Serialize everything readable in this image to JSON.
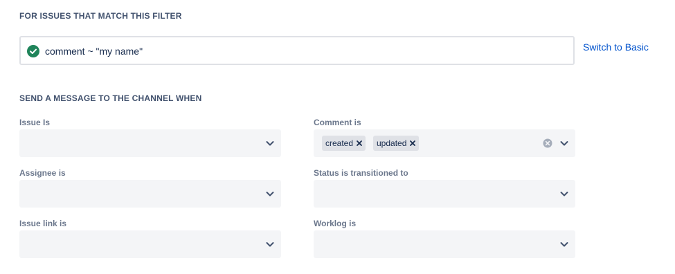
{
  "filter_section": {
    "heading": "FOR ISSUES THAT MATCH THIS FILTER",
    "jql_value": "comment ~ \"my name\"",
    "jql_status": "valid",
    "switch_link": "Switch to Basic"
  },
  "message_section": {
    "heading": "SEND A MESSAGE TO THE CHANNEL WHEN",
    "fields": {
      "issue_is": {
        "label": "Issue Is",
        "selected": []
      },
      "comment_is": {
        "label": "Comment is",
        "selected": [
          "created",
          "updated"
        ]
      },
      "assignee_is": {
        "label": "Assignee is",
        "selected": []
      },
      "status_transitioned": {
        "label": "Status is transitioned to",
        "selected": []
      },
      "issue_link_is": {
        "label": "Issue link is",
        "selected": []
      },
      "worklog_is": {
        "label": "Worklog is",
        "selected": []
      }
    }
  },
  "colors": {
    "success_green": "#1f845a",
    "link_blue": "#0052cc",
    "heading_text": "#42526e",
    "label_text": "#6b778c",
    "select_bg": "#f4f5f7",
    "chip_bg": "#dfe1e6"
  },
  "icons": {
    "jql_status": "check-circle-icon",
    "dropdown": "chevron-down-icon",
    "chip_remove": "cross-icon",
    "clear": "clear-circle-icon"
  }
}
